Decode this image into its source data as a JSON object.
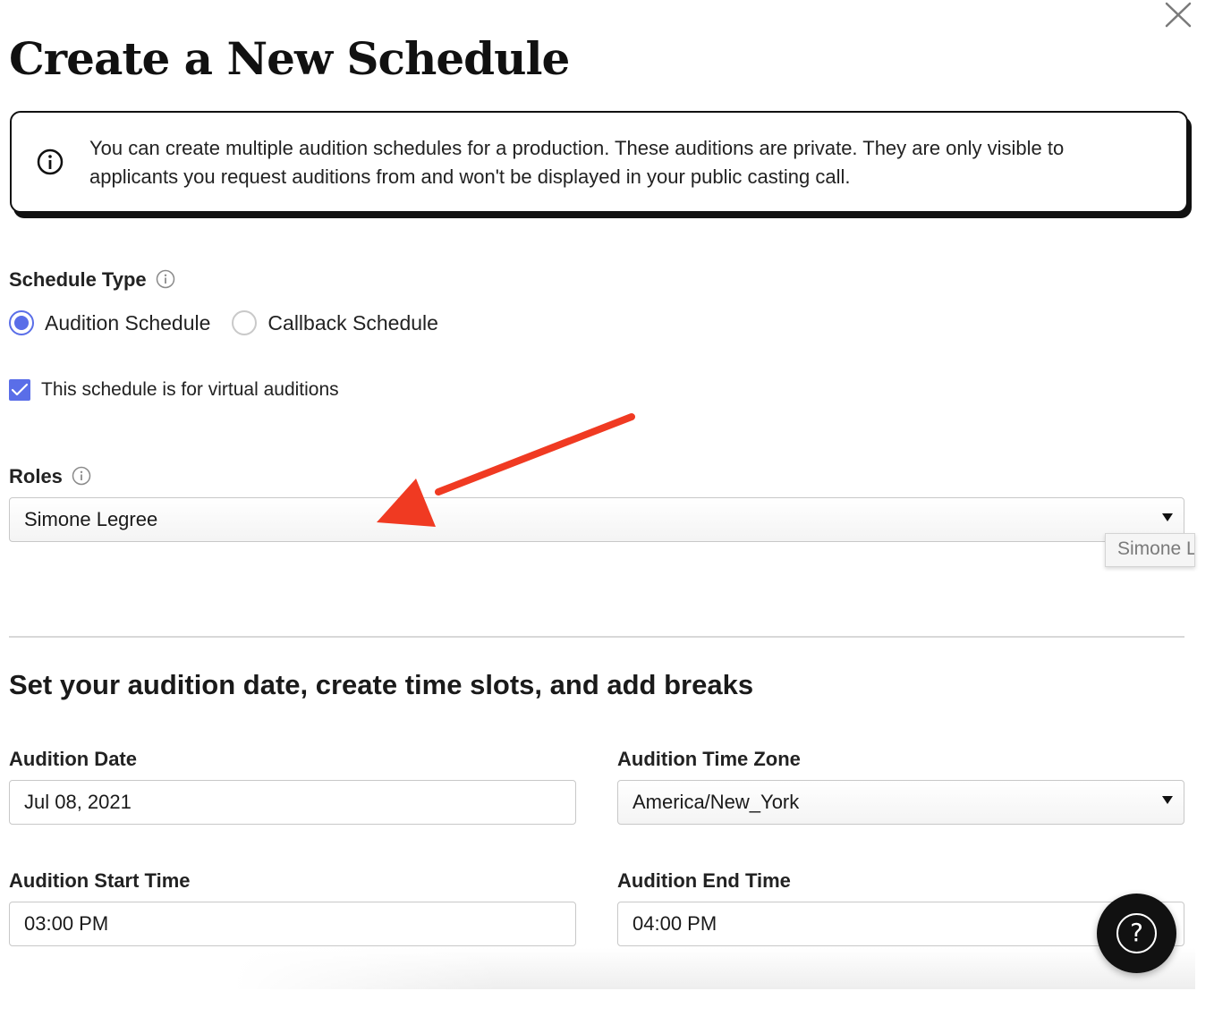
{
  "page": {
    "title": "Create a New Schedule"
  },
  "banner": {
    "icon": "info-circle-icon",
    "text": "You can create multiple audition schedules for a production. These auditions are private. They are only visible to applicants you request auditions from and won't be displayed in your public casting call."
  },
  "schedule_type": {
    "label": "Schedule Type",
    "options": [
      {
        "label": "Audition Schedule",
        "selected": true
      },
      {
        "label": "Callback Schedule",
        "selected": false
      }
    ]
  },
  "virtual": {
    "label": "This schedule is for virtual auditions",
    "checked": true
  },
  "roles": {
    "label": "Roles",
    "selected": "Simone Legree",
    "tooltip": "Simone Legree"
  },
  "section": {
    "title": "Set your audition date, create time slots, and add breaks"
  },
  "fields": {
    "date": {
      "label": "Audition Date",
      "value": "Jul 08, 2021"
    },
    "timezone": {
      "label": "Audition Time Zone",
      "value": "America/New_York"
    },
    "start": {
      "label": "Audition Start Time",
      "value": "03:00 PM"
    },
    "end": {
      "label": "Audition End Time",
      "value": "04:00 PM"
    }
  },
  "help": {
    "glyph": "?"
  },
  "colors": {
    "accent": "#5a6ee8",
    "annotation_arrow": "#f03a22",
    "text": "#1a1a1a"
  }
}
